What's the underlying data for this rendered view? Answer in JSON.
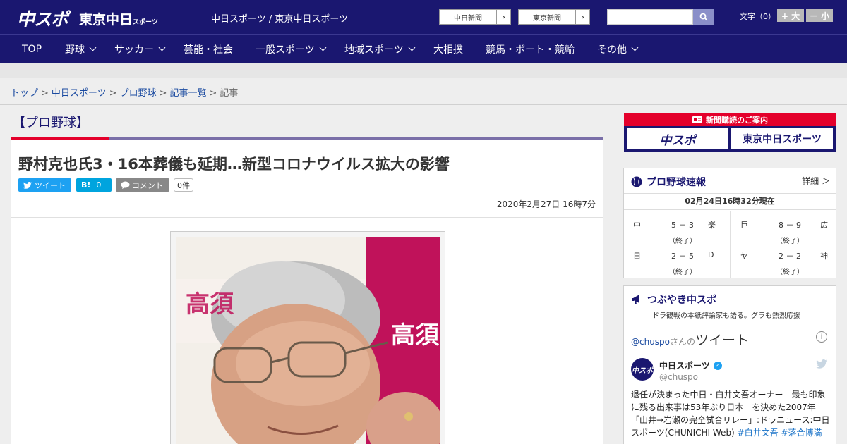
{
  "header": {
    "logo_main": "中スポ",
    "logo_sub": "東京中日",
    "logo_sub_small": "スポーツ",
    "site_name": "中日スポーツ / 東京中日スポーツ",
    "ext_links": [
      "中日新聞",
      "東京新聞"
    ],
    "search_placeholder": "",
    "font_size_label": "文字（0）",
    "font_plus": "+ 大",
    "font_minus": "－ 小"
  },
  "nav": {
    "items": [
      {
        "label": "TOP",
        "dropdown": false
      },
      {
        "label": "野球",
        "dropdown": true
      },
      {
        "label": "サッカー",
        "dropdown": true
      },
      {
        "label": "芸能・社会",
        "dropdown": false
      },
      {
        "label": "一般スポーツ",
        "dropdown": true
      },
      {
        "label": "地域スポーツ",
        "dropdown": true
      },
      {
        "label": "大相撲",
        "dropdown": false
      },
      {
        "label": "競馬・ボート・競輪",
        "dropdown": false
      },
      {
        "label": "その他",
        "dropdown": true
      }
    ]
  },
  "breadcrumb": {
    "links": [
      "トップ",
      "中日スポーツ",
      "プロ野球",
      "記事一覧"
    ],
    "current": "記事"
  },
  "article": {
    "category": "【プロ野球】",
    "headline": "野村克也氏3・16本葬儀も延期…新型コロナウイルス拡大の影響",
    "tweet_label": "ツイート",
    "hatena_label": "B!",
    "hatena_count": "0",
    "comment_label": "コメント",
    "comment_count": "0件",
    "date": "2020年2月27日 16時7分",
    "photo_bg_text_1": "高須",
    "photo_bg_text_2": "高須"
  },
  "sidebar": {
    "promo_title": "新聞購読のご案内",
    "promo_buttons": [
      "中スポ",
      "東京中日スポーツ"
    ],
    "scores": {
      "title": "プロ野球速報",
      "detail": "詳細 ＞",
      "as_of": "02月24日16時32分現在",
      "games": [
        {
          "home": "中",
          "score": "5 － 3",
          "away": "楽",
          "status": "（終了）"
        },
        {
          "home": "巨",
          "score": "8 － 9",
          "away": "広",
          "status": "（終了）"
        },
        {
          "home": "日",
          "score": "2 － 5",
          "away": "D",
          "status": "（終了）"
        },
        {
          "home": "ヤ",
          "score": "2 － 2",
          "away": "神",
          "status": "（終了）"
        }
      ]
    },
    "tweets": {
      "title": "つぶやき中スポ",
      "subtitle": "ドラ観戦の本紙評論家も語る。グラも熱烈応援",
      "handle_link": "@chuspo",
      "san": "さんの",
      "tweet_word": "ツイート",
      "author_name": "中日スポーツ",
      "author_handle": "@chuspo",
      "avatar_text": "中スポ",
      "text": "退任が決まった中日・白井文吾オーナー　最も印象に残る出来事は53年ぶり日本一を決めた2007年「山井→岩瀬の完全試合リレー」:ドラニュース:中日スポーツ(CHUNICHI Web)",
      "hashtags": [
        "#白井文吾",
        "#落合博満"
      ]
    }
  },
  "colors": {
    "brand_navy": "#1a1770",
    "accent_red": "#e4002b",
    "twitter_blue": "#1da1f2",
    "hatena_blue": "#00a4de"
  }
}
